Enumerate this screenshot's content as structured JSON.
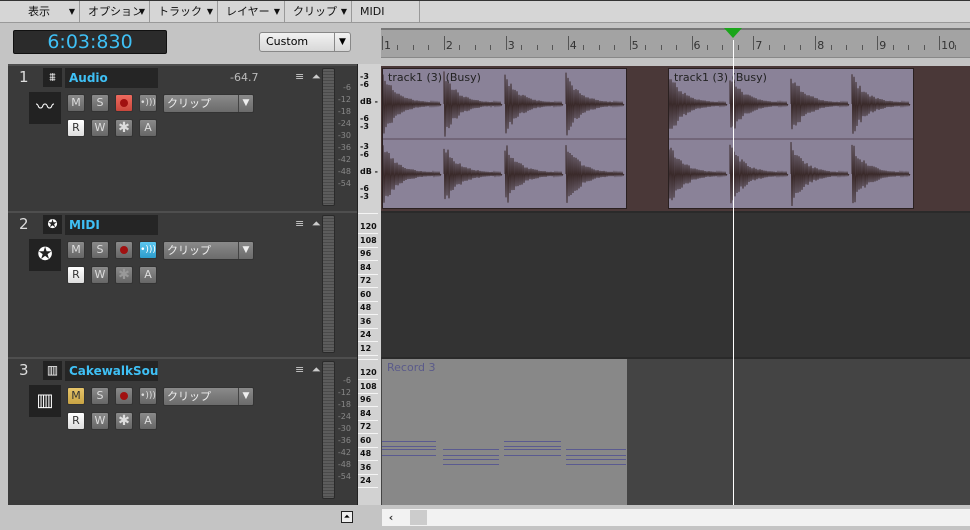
{
  "menu": [
    "表示",
    "オプション",
    "トラック",
    "レイヤー",
    "クリップ",
    "MIDI"
  ],
  "transport": {
    "time": "6:03:830"
  },
  "preset": {
    "value": "Custom"
  },
  "ruler": {
    "measures": [
      "1",
      "2",
      "3",
      "4",
      "5",
      "6",
      "7",
      "8",
      "9",
      "10"
    ],
    "playhead_measure": 6.6
  },
  "tracks": [
    {
      "number": "1",
      "name": "Audio",
      "type": "audio",
      "volume": "-64.7",
      "input": "クリップ",
      "mute": false,
      "echo": false,
      "clips": [
        {
          "name": "track1 (3) (Busy)"
        },
        {
          "name": "track1 (3) (Busy)"
        }
      ]
    },
    {
      "number": "2",
      "name": "MIDI",
      "type": "midi",
      "input": "クリップ",
      "mute": false,
      "echo": true
    },
    {
      "number": "3",
      "name": "CakewalkSou",
      "type": "instrument",
      "input": "クリップ",
      "mute": true,
      "echo": false,
      "clips": [
        {
          "name": "Record 3"
        }
      ]
    }
  ],
  "buttons": {
    "mute": "M",
    "solo": "S",
    "read": "R",
    "write": "W",
    "freeze": "✱",
    "arm": "A",
    "tools": "≡ ⏶"
  },
  "meter_scale": [
    "-6",
    "-12",
    "-18",
    "-24",
    "-30",
    "-36",
    "-42",
    "-48",
    "-54"
  ],
  "audio_scale": [
    "-3",
    "-6",
    "dB -",
    "-6",
    "-3",
    "-3",
    "-6",
    "dB -",
    "-6",
    "-3"
  ],
  "midi_scale": [
    "120",
    "108",
    "96",
    "84",
    "72",
    "60",
    "48",
    "36",
    "24",
    "12"
  ],
  "colors": {
    "accent": "#3fc0f5",
    "playhead": "#1aa51a",
    "audio_clip": "#8a8298",
    "midi_clip": "#888888"
  }
}
